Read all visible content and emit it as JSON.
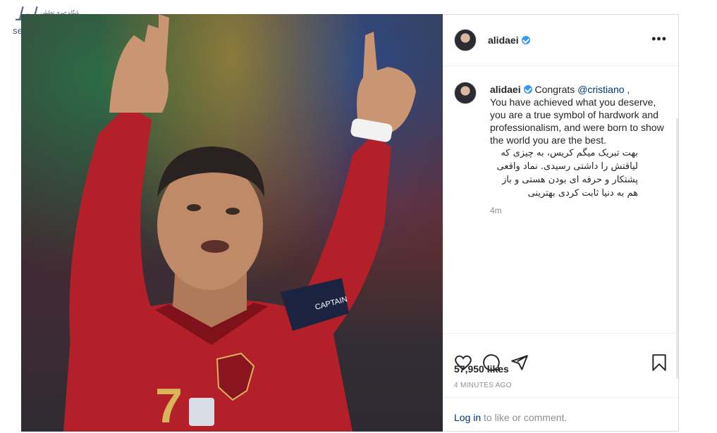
{
  "watermark": {
    "logo": "صراط",
    "tagline": "پایگاه خبری تحلیلی",
    "site": "seratnews.ir"
  },
  "post": {
    "username": "alidaei",
    "caption": {
      "username": "alidaei",
      "congrats": "Congrats",
      "mention": "@cristiano",
      "after_mention": " ,",
      "english": "You have achieved what you deserve, you are a true symbol of hardwork and professionalism, and were born to show the world you are the best.",
      "persian": "بهت تبریک میگم کریس، به چیزی که لیاقتش را داشتی رسیدی. نماد واقعی پشتکار و حرفه ای بودن هستی و باز هم به دنیا ثابت کردی بهترینی",
      "time_ago": "4m"
    },
    "likes": "57,950 likes",
    "date": "4 MINUTES AGO",
    "login": {
      "link": "Log in",
      "rest": " to like or comment."
    },
    "photo": {
      "jersey_number": "7",
      "armband_text": "CAPTAIN"
    }
  },
  "icons": [
    "more-icon",
    "heart-icon",
    "comment-icon",
    "share-icon",
    "bookmark-icon",
    "verified-icon"
  ],
  "colors": {
    "verified": "#3897f0",
    "link": "#00376b",
    "muted": "#8e8e8e",
    "jersey_red": "#b3202a"
  }
}
